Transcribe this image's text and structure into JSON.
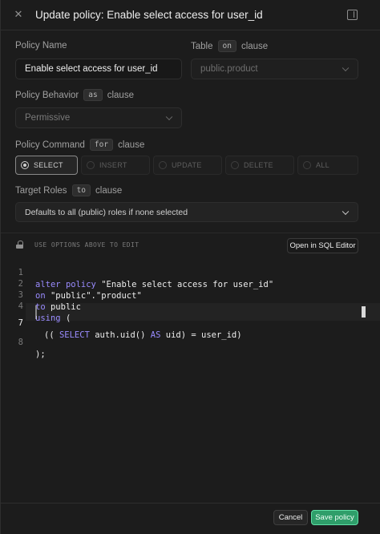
{
  "header": {
    "title": "Update policy: Enable select access for user_id",
    "close_icon": "close-icon",
    "toggle_icon": "sidebar-toggle-icon"
  },
  "form": {
    "policy_name": {
      "label": "Policy Name",
      "value": "Enable select access for user_id"
    },
    "table": {
      "label": "Table",
      "chip": "on",
      "suffix": "clause",
      "value": "public.product"
    },
    "behavior": {
      "label": "Policy Behavior",
      "chip": "as",
      "suffix": "clause",
      "value": "Permissive"
    },
    "command": {
      "label": "Policy Command",
      "chip": "for",
      "suffix": "clause",
      "options": [
        "SELECT",
        "INSERT",
        "UPDATE",
        "DELETE",
        "ALL"
      ],
      "selected": "SELECT"
    },
    "roles": {
      "label": "Target Roles",
      "chip": "to",
      "suffix": "clause",
      "placeholder": "Defaults to all (public) roles if none selected"
    }
  },
  "editor": {
    "hint": "USE OPTIONS ABOVE TO EDIT",
    "open_sql_label": "Open in SQL Editor",
    "lines": [
      {
        "n": "1",
        "text": "alter policy \"Enable select access for user_id\""
      },
      {
        "n": "2",
        "text": "on \"public\".\"product\""
      },
      {
        "n": "3",
        "text": "to public"
      },
      {
        "n": "4",
        "text": "using ("
      },
      {
        "n": "7",
        "text": "(( SELECT auth.uid() AS uid) = user_id)"
      },
      {
        "n": "8",
        "text": ");"
      }
    ]
  },
  "footer": {
    "cancel_label": "Cancel",
    "save_label": "Save policy"
  },
  "colors": {
    "accent": "#3ecf8e",
    "keyword": "#9a8cff",
    "background": "#1c1c1c"
  }
}
